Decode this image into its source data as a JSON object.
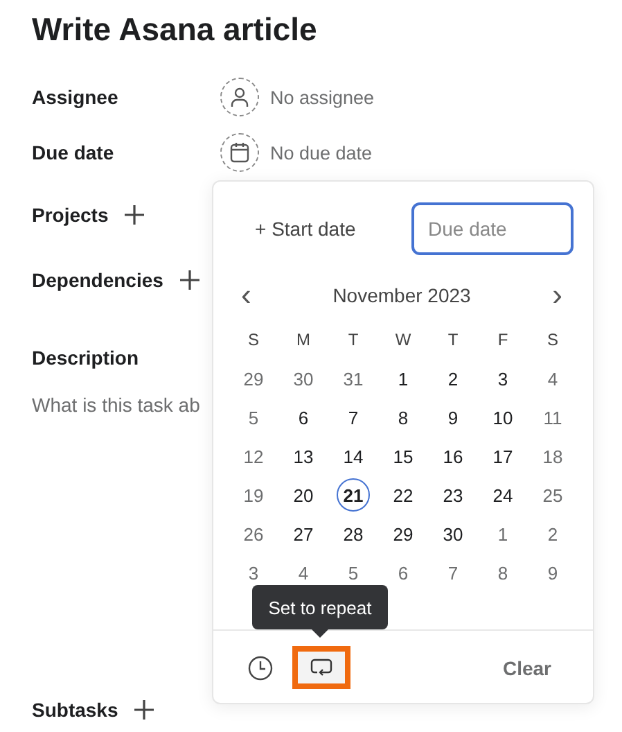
{
  "title": "Write Asana article",
  "fields": [
    {
      "label": "Assignee",
      "kind": "person",
      "value": "No assignee"
    },
    {
      "label": "Due date",
      "kind": "calendar",
      "value": "No due date"
    },
    {
      "label": "Projects",
      "kind": "add"
    },
    {
      "label": "Dependencies",
      "kind": "add"
    }
  ],
  "description": {
    "label": "Description",
    "placeholder": "What is this task ab"
  },
  "subtasks": {
    "label": "Subtasks"
  },
  "date_picker": {
    "start_date": "+ Start date",
    "due_date_placeholder": "Due date",
    "month": "November 2023",
    "prev": "‹",
    "next": "›",
    "weekdays": [
      "S",
      "M",
      "T",
      "W",
      "T",
      "F",
      "S"
    ],
    "days": [
      {
        "d": "29",
        "muted": true,
        "today": false
      },
      {
        "d": "30",
        "muted": true,
        "today": false
      },
      {
        "d": "31",
        "muted": true,
        "today": false
      },
      {
        "d": "1",
        "muted": false,
        "today": false
      },
      {
        "d": "2",
        "muted": false,
        "today": false
      },
      {
        "d": "3",
        "muted": false,
        "today": false
      },
      {
        "d": "4",
        "muted": true,
        "today": false
      },
      {
        "d": "5",
        "muted": true,
        "today": false
      },
      {
        "d": "6",
        "muted": false,
        "today": false
      },
      {
        "d": "7",
        "muted": false,
        "today": false
      },
      {
        "d": "8",
        "muted": false,
        "today": false
      },
      {
        "d": "9",
        "muted": false,
        "today": false
      },
      {
        "d": "10",
        "muted": false,
        "today": false
      },
      {
        "d": "11",
        "muted": true,
        "today": false
      },
      {
        "d": "12",
        "muted": true,
        "today": false
      },
      {
        "d": "13",
        "muted": false,
        "today": false
      },
      {
        "d": "14",
        "muted": false,
        "today": false
      },
      {
        "d": "15",
        "muted": false,
        "today": false
      },
      {
        "d": "16",
        "muted": false,
        "today": false
      },
      {
        "d": "17",
        "muted": false,
        "today": false
      },
      {
        "d": "18",
        "muted": true,
        "today": false
      },
      {
        "d": "19",
        "muted": true,
        "today": false
      },
      {
        "d": "20",
        "muted": false,
        "today": false
      },
      {
        "d": "21",
        "muted": false,
        "today": true
      },
      {
        "d": "22",
        "muted": false,
        "today": false
      },
      {
        "d": "23",
        "muted": false,
        "today": false
      },
      {
        "d": "24",
        "muted": false,
        "today": false
      },
      {
        "d": "25",
        "muted": true,
        "today": false
      },
      {
        "d": "26",
        "muted": true,
        "today": false
      },
      {
        "d": "27",
        "muted": false,
        "today": false
      },
      {
        "d": "28",
        "muted": false,
        "today": false
      },
      {
        "d": "29",
        "muted": false,
        "today": false
      },
      {
        "d": "30",
        "muted": false,
        "today": false
      },
      {
        "d": "1",
        "muted": true,
        "today": false
      },
      {
        "d": "2",
        "muted": true,
        "today": false
      },
      {
        "d": "3",
        "muted": true,
        "today": false
      },
      {
        "d": "4",
        "muted": true,
        "today": false
      },
      {
        "d": "5",
        "muted": true,
        "today": false
      },
      {
        "d": "6",
        "muted": true,
        "today": false
      },
      {
        "d": "7",
        "muted": true,
        "today": false
      },
      {
        "d": "8",
        "muted": true,
        "today": false
      },
      {
        "d": "9",
        "muted": true,
        "today": false
      }
    ],
    "tooltip": "Set to repeat",
    "repeat_highlighted": true,
    "clear": "Clear"
  }
}
